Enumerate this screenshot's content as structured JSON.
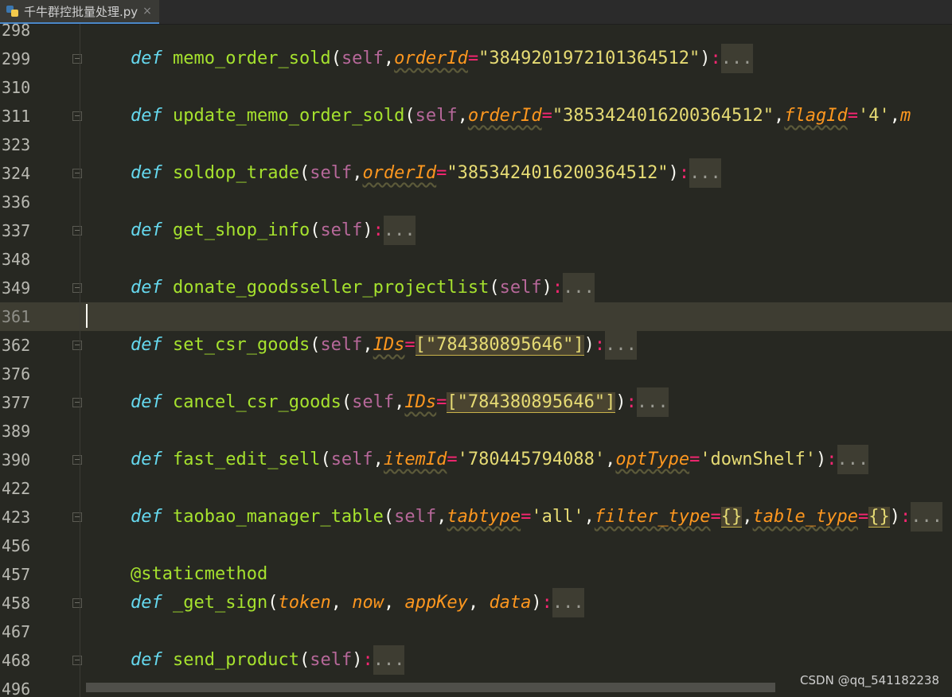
{
  "tab": {
    "label": "千牛群控批量处理.py",
    "close": "×",
    "icon": "python-file-icon"
  },
  "lines": [
    {
      "num": "298"
    },
    {
      "num": "299",
      "name": "memo_order_sold",
      "params": [
        {
          "name": "orderId",
          "value": "\"3849201972101364512\""
        }
      ],
      "fold": true
    },
    {
      "num": "310"
    },
    {
      "num": "311",
      "name": "update_memo_order_sold",
      "params": [
        {
          "name": "orderId",
          "value": "\"3853424016200364512\""
        },
        {
          "name": "flagId",
          "value": "'4'"
        }
      ],
      "tail": ",m",
      "fold": true
    },
    {
      "num": "323"
    },
    {
      "num": "324",
      "name": "soldop_trade",
      "params": [
        {
          "name": "orderId",
          "value": "\"3853424016200364512\""
        }
      ],
      "fold": true
    },
    {
      "num": "336"
    },
    {
      "num": "337",
      "name": "get_shop_info",
      "fold": true
    },
    {
      "num": "348"
    },
    {
      "num": "349",
      "name": "donate_goodsseller_projectlist",
      "fold": true
    },
    {
      "num": "361",
      "current": true
    },
    {
      "num": "362",
      "name": "set_csr_goods",
      "params": [
        {
          "name": "IDs",
          "value": "[\"784380895646\"]",
          "highlight": true
        }
      ],
      "fold": true
    },
    {
      "num": "376"
    },
    {
      "num": "377",
      "name": "cancel_csr_goods",
      "params": [
        {
          "name": "IDs",
          "value": "[\"784380895646\"]",
          "highlight": true
        }
      ],
      "fold": true
    },
    {
      "num": "389"
    },
    {
      "num": "390",
      "name": "fast_edit_sell",
      "params": [
        {
          "name": "itemId",
          "value": "'780445794088'"
        },
        {
          "name": "optType",
          "value": "'downShelf'"
        }
      ],
      "fold": true
    },
    {
      "num": "422"
    },
    {
      "num": "423",
      "name": "taobao_manager_table",
      "params": [
        {
          "name": "tabtype",
          "value": "'all'"
        },
        {
          "name": "filter_type",
          "value": "{}",
          "highlight": true
        },
        {
          "name": "table_type",
          "value": "{}",
          "highlight": true
        }
      ],
      "fold": true
    },
    {
      "num": "456"
    },
    {
      "num": "457",
      "decorator": "@staticmethod"
    },
    {
      "num": "458",
      "name": "_get_sign",
      "noself": true,
      "args": [
        "token",
        "now",
        "appKey",
        "data"
      ],
      "fold": true
    },
    {
      "num": "467"
    },
    {
      "num": "468",
      "name": "send_product",
      "fold": true
    },
    {
      "num": "496"
    }
  ],
  "keyword": "def",
  "self_word": "self",
  "ellipsis": "...",
  "watermark": "CSDN @qq_541182238",
  "colors": {
    "keyword": "#66d9ef",
    "function": "#a6e22e",
    "param": "#fd971f",
    "string": "#e6db74",
    "operator": "#f92672",
    "self": "#b7689a",
    "background": "#272822"
  }
}
